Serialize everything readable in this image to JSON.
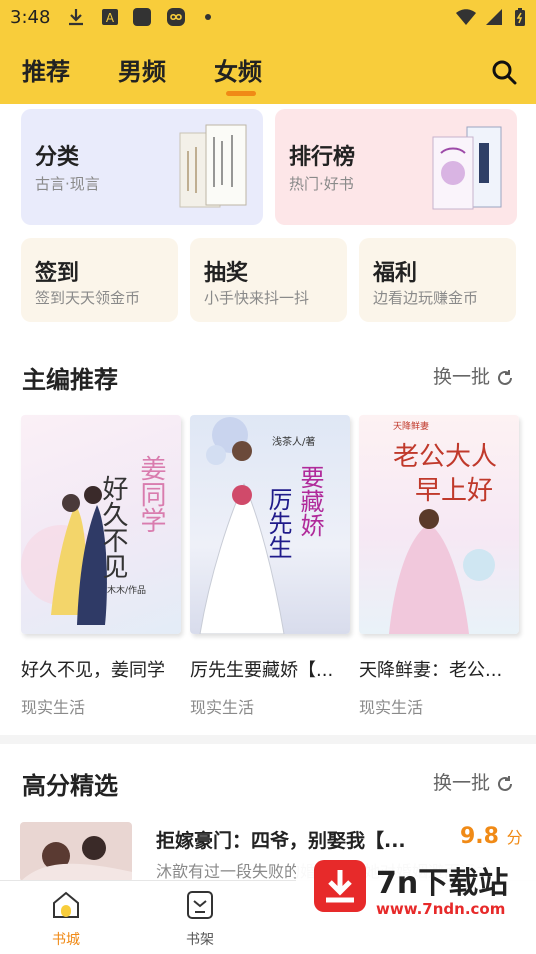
{
  "status_bar": {
    "time": "3:48"
  },
  "tabs": [
    {
      "label": "推荐"
    },
    {
      "label": "男频"
    },
    {
      "label": "女频"
    }
  ],
  "active_tab_index": 2,
  "categories": {
    "big": [
      {
        "title": "分类",
        "subtitle": "古言·现言"
      },
      {
        "title": "排行榜",
        "subtitle": "热门·好书"
      }
    ],
    "small": [
      {
        "title": "签到",
        "subtitle": "签到天天领金币"
      },
      {
        "title": "抽奖",
        "subtitle": "小手快来抖一抖"
      },
      {
        "title": "福利",
        "subtitle": "边看边玩赚金币"
      }
    ]
  },
  "editor_picks": {
    "title": "主编推荐",
    "refresh_label": "换一批",
    "books": [
      {
        "title": "好久不见，姜同学",
        "category": "现实生活",
        "cover_text": "好久不见",
        "cover_text2": "姜同学",
        "cover_author": "木木/作品"
      },
      {
        "title": "厉先生要藏娇【...",
        "category": "现实生活",
        "cover_text": "厉先生",
        "cover_text2": "要藏娇",
        "cover_author": "浅茶人/著"
      },
      {
        "title": "天降鲜妻：老公...",
        "category": "现实生活",
        "cover_text": "老公大人",
        "cover_text2": "早上好",
        "cover_author": "天降鲜妻"
      }
    ]
  },
  "high_score": {
    "title": "高分精选",
    "refresh_label": "换一批",
    "item": {
      "title": "拒嫁豪门：四爷，别娶我【...",
      "score": "9.8",
      "score_unit": "分",
      "desc": "沐歆有过一段失败的婚姻，让她对婚姻避而远之"
    }
  },
  "bottom_nav": [
    {
      "label": "书城"
    },
    {
      "label": "书架"
    }
  ],
  "watermark": {
    "name": "7n下载站",
    "url": "www.7ndn.com"
  },
  "colors": {
    "header": "#f8cd3b",
    "accent": "#f08a16",
    "card_category": "#e9ebfb",
    "card_rank": "#fde6e8",
    "card_small": "#fbf5ea"
  }
}
